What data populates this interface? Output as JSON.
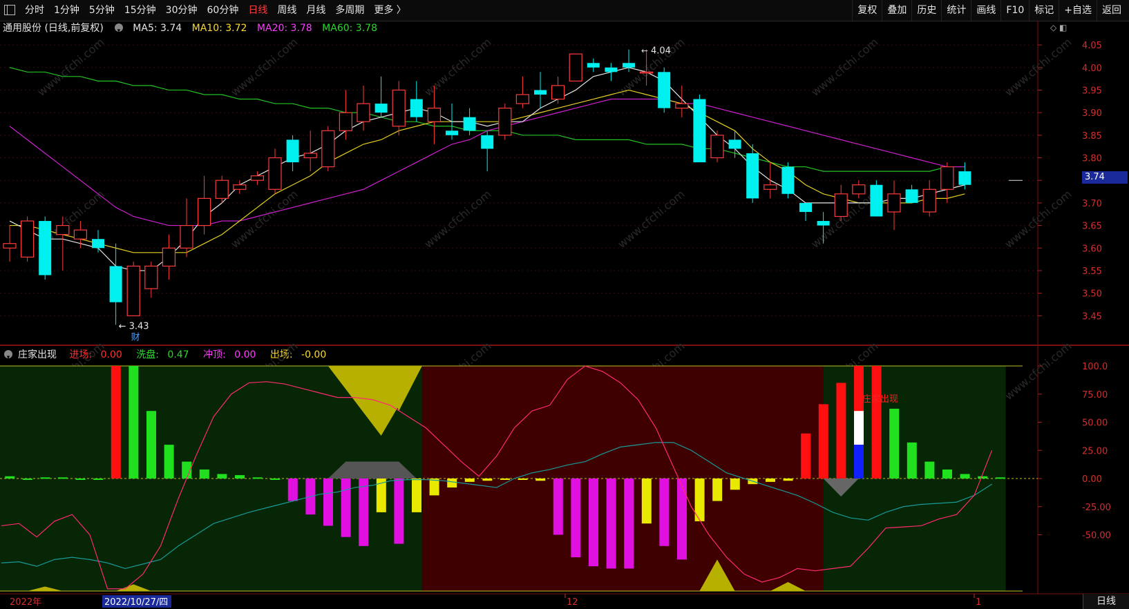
{
  "toolbar": {
    "tabs": [
      "分时",
      "1分钟",
      "5分钟",
      "15分钟",
      "30分钟",
      "60分钟",
      "日线",
      "周线",
      "月线",
      "多周期",
      "更多 〉"
    ],
    "active_index": 6,
    "right": [
      "复权",
      "叠加",
      "历史",
      "统计",
      "画线",
      "F10",
      "标记",
      "+自选",
      "返回"
    ]
  },
  "info": {
    "title": "通用股份 (日线,前复权)",
    "ma5": "MA5: 3.74",
    "ma10": "MA10: 3.72",
    "ma20": "MA20: 3.78",
    "ma60": "MA60: 3.78"
  },
  "indicator": {
    "name": "庄家出现",
    "entry_label": "进场:",
    "entry_val": "0.00",
    "wash_label": "洗盘:",
    "wash_val": "0.47",
    "top_label": "冲顶:",
    "top_val": "0.00",
    "exit_label": "出场:",
    "exit_val": "-0.00",
    "annotation": "庄家出现"
  },
  "price_axis": [
    "4.05",
    "4.00",
    "3.95",
    "3.90",
    "3.85",
    "3.80",
    "3.75",
    "3.70",
    "3.65",
    "3.60",
    "3.55",
    "3.50",
    "3.45"
  ],
  "ind_axis": [
    "100.0",
    "75.00",
    "50.00",
    "25.00",
    "0.00",
    "-25.00",
    "-50.00"
  ],
  "current_price": "3.74",
  "high_label": "4.04",
  "low_label": "3.43",
  "cai_label": "财",
  "date_axis": {
    "left": "2022年",
    "cursor": "2022/10/27/四",
    "mid": "12",
    "right": "1"
  },
  "bottom_right": "日线",
  "watermark": "www.cfchi.com",
  "chart_data": {
    "type": "candlestick",
    "candles": [
      {
        "o": 3.6,
        "c": 3.61,
        "h": 3.65,
        "l": 3.57
      },
      {
        "o": 3.58,
        "c": 3.66,
        "h": 3.67,
        "l": 3.57
      },
      {
        "o": 3.66,
        "c": 3.54,
        "h": 3.67,
        "l": 3.53
      },
      {
        "o": 3.63,
        "c": 3.65,
        "h": 3.67,
        "l": 3.55
      },
      {
        "o": 3.62,
        "c": 3.64,
        "h": 3.66,
        "l": 3.6
      },
      {
        "o": 3.62,
        "c": 3.6,
        "h": 3.64,
        "l": 3.59
      },
      {
        "o": 3.56,
        "c": 3.48,
        "h": 3.61,
        "l": 3.43
      },
      {
        "o": 3.45,
        "c": 3.56,
        "h": 3.57,
        "l": 3.45
      },
      {
        "o": 3.51,
        "c": 3.56,
        "h": 3.57,
        "l": 3.49
      },
      {
        "o": 3.56,
        "c": 3.6,
        "h": 3.63,
        "l": 3.53
      },
      {
        "o": 3.6,
        "c": 3.65,
        "h": 3.71,
        "l": 3.58
      },
      {
        "o": 3.65,
        "c": 3.71,
        "h": 3.76,
        "l": 3.63
      },
      {
        "o": 3.71,
        "c": 3.75,
        "h": 3.76,
        "l": 3.7
      },
      {
        "o": 3.73,
        "c": 3.74,
        "h": 3.75,
        "l": 3.72
      },
      {
        "o": 3.75,
        "c": 3.76,
        "h": 3.77,
        "l": 3.74
      },
      {
        "o": 3.73,
        "c": 3.8,
        "h": 3.82,
        "l": 3.72
      },
      {
        "o": 3.84,
        "c": 3.79,
        "h": 3.85,
        "l": 3.77
      },
      {
        "o": 3.8,
        "c": 3.81,
        "h": 3.86,
        "l": 3.77
      },
      {
        "o": 3.78,
        "c": 3.86,
        "h": 3.87,
        "l": 3.77
      },
      {
        "o": 3.86,
        "c": 3.9,
        "h": 3.95,
        "l": 3.84
      },
      {
        "o": 3.88,
        "c": 3.92,
        "h": 3.96,
        "l": 3.86
      },
      {
        "o": 3.92,
        "c": 3.9,
        "h": 3.98,
        "l": 3.89
      },
      {
        "o": 3.87,
        "c": 3.95,
        "h": 3.97,
        "l": 3.85
      },
      {
        "o": 3.93,
        "c": 3.89,
        "h": 3.97,
        "l": 3.88
      },
      {
        "o": 3.88,
        "c": 3.91,
        "h": 3.96,
        "l": 3.83
      },
      {
        "o": 3.86,
        "c": 3.85,
        "h": 3.92,
        "l": 3.84
      },
      {
        "o": 3.89,
        "c": 3.86,
        "h": 3.91,
        "l": 3.85
      },
      {
        "o": 3.85,
        "c": 3.82,
        "h": 3.86,
        "l": 3.77
      },
      {
        "o": 3.85,
        "c": 3.91,
        "h": 3.92,
        "l": 3.84
      },
      {
        "o": 3.92,
        "c": 3.94,
        "h": 3.98,
        "l": 3.91
      },
      {
        "o": 3.95,
        "c": 3.94,
        "h": 3.99,
        "l": 3.91
      },
      {
        "o": 3.93,
        "c": 3.96,
        "h": 3.98,
        "l": 3.92
      },
      {
        "o": 3.97,
        "c": 4.03,
        "h": 4.03,
        "l": 3.97
      },
      {
        "o": 4.01,
        "c": 4.0,
        "h": 4.02,
        "l": 3.99
      },
      {
        "o": 4.0,
        "c": 3.99,
        "h": 4.01,
        "l": 3.97
      },
      {
        "o": 4.01,
        "c": 4.0,
        "h": 4.04,
        "l": 3.99
      },
      {
        "o": 3.99,
        "c": 3.99,
        "h": 4.04,
        "l": 3.96
      },
      {
        "o": 3.99,
        "c": 3.91,
        "h": 4.0,
        "l": 3.9
      },
      {
        "o": 3.91,
        "c": 3.92,
        "h": 3.96,
        "l": 3.89
      },
      {
        "o": 3.93,
        "c": 3.79,
        "h": 3.94,
        "l": 3.79
      },
      {
        "o": 3.8,
        "c": 3.85,
        "h": 3.86,
        "l": 3.79
      },
      {
        "o": 3.84,
        "c": 3.82,
        "h": 3.86,
        "l": 3.8
      },
      {
        "o": 3.81,
        "c": 3.71,
        "h": 3.83,
        "l": 3.7
      },
      {
        "o": 3.73,
        "c": 3.74,
        "h": 3.79,
        "l": 3.71
      },
      {
        "o": 3.78,
        "c": 3.72,
        "h": 3.79,
        "l": 3.71
      },
      {
        "o": 3.7,
        "c": 3.68,
        "h": 3.7,
        "l": 3.66
      },
      {
        "o": 3.66,
        "c": 3.65,
        "h": 3.68,
        "l": 3.61
      },
      {
        "o": 3.67,
        "c": 3.72,
        "h": 3.74,
        "l": 3.66
      },
      {
        "o": 3.72,
        "c": 3.74,
        "h": 3.75,
        "l": 3.71
      },
      {
        "o": 3.74,
        "c": 3.67,
        "h": 3.75,
        "l": 3.67
      },
      {
        "o": 3.68,
        "c": 3.72,
        "h": 3.75,
        "l": 3.64
      },
      {
        "o": 3.73,
        "c": 3.7,
        "h": 3.74,
        "l": 3.7
      },
      {
        "o": 3.68,
        "c": 3.73,
        "h": 3.75,
        "l": 3.67
      },
      {
        "o": 3.73,
        "c": 3.78,
        "h": 3.79,
        "l": 3.7
      },
      {
        "o": 3.77,
        "c": 3.74,
        "h": 3.79,
        "l": 3.73
      }
    ],
    "ma5": [
      3.66,
      3.64,
      3.62,
      3.62,
      3.61,
      3.6,
      3.56,
      3.55,
      3.55,
      3.58,
      3.62,
      3.67,
      3.7,
      3.74,
      3.76,
      3.78,
      3.8,
      3.81,
      3.83,
      3.86,
      3.88,
      3.89,
      3.9,
      3.91,
      3.9,
      3.88,
      3.88,
      3.87,
      3.88,
      3.88,
      3.91,
      3.93,
      3.95,
      3.98,
      3.99,
      4.0,
      3.99,
      3.97,
      3.93,
      3.89,
      3.85,
      3.82,
      3.78,
      3.75,
      3.73,
      3.7,
      3.7,
      3.7,
      3.7,
      3.7,
      3.71,
      3.71,
      3.72,
      3.73,
      3.74
    ],
    "ma10": [
      3.65,
      3.65,
      3.64,
      3.63,
      3.62,
      3.61,
      3.6,
      3.59,
      3.59,
      3.59,
      3.59,
      3.61,
      3.63,
      3.66,
      3.69,
      3.72,
      3.74,
      3.76,
      3.79,
      3.81,
      3.83,
      3.84,
      3.86,
      3.87,
      3.88,
      3.88,
      3.88,
      3.88,
      3.88,
      3.89,
      3.9,
      3.91,
      3.92,
      3.93,
      3.94,
      3.95,
      3.94,
      3.93,
      3.92,
      3.9,
      3.88,
      3.86,
      3.82,
      3.79,
      3.77,
      3.74,
      3.72,
      3.71,
      3.7,
      3.7,
      3.7,
      3.7,
      3.71,
      3.71,
      3.72
    ],
    "ma20": [
      3.87,
      3.84,
      3.81,
      3.78,
      3.75,
      3.72,
      3.69,
      3.67,
      3.66,
      3.65,
      3.65,
      3.65,
      3.66,
      3.66,
      3.67,
      3.68,
      3.69,
      3.7,
      3.71,
      3.72,
      3.73,
      3.75,
      3.77,
      3.79,
      3.81,
      3.83,
      3.84,
      3.86,
      3.87,
      3.88,
      3.89,
      3.9,
      3.91,
      3.92,
      3.93,
      3.93,
      3.93,
      3.93,
      3.92,
      3.92,
      3.91,
      3.9,
      3.89,
      3.88,
      3.87,
      3.86,
      3.85,
      3.84,
      3.83,
      3.82,
      3.81,
      3.8,
      3.79,
      3.78,
      3.78
    ],
    "ma60": [
      4.0,
      3.99,
      3.99,
      3.98,
      3.98,
      3.97,
      3.97,
      3.96,
      3.96,
      3.95,
      3.95,
      3.94,
      3.94,
      3.93,
      3.93,
      3.92,
      3.92,
      3.91,
      3.91,
      3.9,
      3.9,
      3.89,
      3.88,
      3.88,
      3.87,
      3.87,
      3.86,
      3.86,
      3.86,
      3.85,
      3.85,
      3.85,
      3.84,
      3.84,
      3.84,
      3.84,
      3.83,
      3.83,
      3.83,
      3.82,
      3.82,
      3.81,
      3.8,
      3.79,
      3.78,
      3.78,
      3.77,
      3.77,
      3.77,
      3.77,
      3.77,
      3.77,
      3.77,
      3.78,
      3.78
    ],
    "ind_bars": [
      2,
      -1,
      1,
      1,
      -1,
      -1,
      100,
      100,
      60,
      30,
      15,
      8,
      4,
      3,
      1,
      -1,
      -20,
      -32,
      -42,
      -52,
      -60,
      -30,
      -58,
      -30,
      -15,
      -8,
      -3,
      -2,
      -1,
      -1,
      -2,
      -50,
      -70,
      -78,
      -80,
      -80,
      -40,
      -60,
      -72,
      -38,
      -20,
      -10,
      -5,
      -3,
      -2,
      40,
      66,
      85,
      100,
      100,
      62,
      32,
      15,
      8,
      4,
      2,
      1
    ],
    "ind_bar_colors": [
      "g",
      "g",
      "g",
      "g",
      "g",
      "g",
      "r",
      "g",
      "g",
      "g",
      "g",
      "g",
      "g",
      "g",
      "g",
      "g",
      "m",
      "m",
      "m",
      "m",
      "m",
      "y",
      "m",
      "y",
      "y",
      "y",
      "y",
      "y",
      "y",
      "y",
      "y",
      "m",
      "m",
      "m",
      "m",
      "m",
      "y",
      "m",
      "m",
      "y",
      "y",
      "y",
      "y",
      "y",
      "y",
      "r",
      "r",
      "r",
      "r",
      "r",
      "g",
      "g",
      "g",
      "g",
      "g",
      "g",
      "g"
    ],
    "pink_line": [
      -42,
      -40,
      -52,
      -38,
      -32,
      -50,
      -98,
      -98,
      -85,
      -60,
      -18,
      20,
      55,
      75,
      85,
      86,
      84,
      80,
      76,
      72,
      72,
      70,
      65,
      55,
      45,
      30,
      15,
      2,
      20,
      45,
      60,
      65,
      88,
      100,
      95,
      85,
      70,
      45,
      10,
      -25,
      -50,
      -70,
      -85,
      -92,
      -88,
      -80,
      -82,
      -80,
      -78,
      -62,
      -44,
      -43,
      -42,
      -36,
      -32,
      -15,
      25
    ],
    "teal_line": [
      -75,
      -74,
      -78,
      -72,
      -70,
      -72,
      -75,
      -80,
      -76,
      -72,
      -60,
      -50,
      -40,
      -35,
      -30,
      -26,
      -22,
      -18,
      -14,
      -12,
      -8,
      -6,
      -2,
      -1,
      -1,
      -2,
      -4,
      -6,
      -8,
      0,
      5,
      8,
      12,
      15,
      22,
      28,
      30,
      32,
      32,
      25,
      15,
      5,
      0,
      -5,
      -10,
      -15,
      -22,
      -30,
      -35,
      -37,
      -30,
      -25,
      -23,
      -22,
      -21,
      -15,
      -5
    ]
  }
}
